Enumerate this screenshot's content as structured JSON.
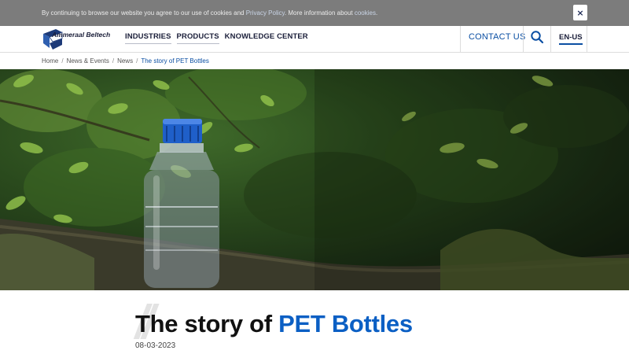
{
  "cookie_bar": {
    "text_before": "By continuing to browse our website you agree to our use of cookies and ",
    "privacy_link": "Privacy Policy",
    "text_middle": ". More information about ",
    "cookies_link": "cookies",
    "text_after": ".",
    "close_label": "×"
  },
  "header": {
    "logo_text": "Ammeraal Beltech",
    "nav": [
      "INDUSTRIES",
      "PRODUCTS",
      "KNOWLEDGE CENTER"
    ],
    "contact_label": "CONTACT US",
    "search_icon": "search-icon",
    "language": "EN-US"
  },
  "breadcrumb": [
    "Home",
    "News & Events",
    "News",
    "The story of PET Bottles"
  ],
  "article": {
    "title_plain": "The story of ",
    "title_accent": "PET Bottles",
    "date": "08-03-2023"
  },
  "colors": {
    "brand_blue": "#0b4fa3",
    "title_accent": "#0b5fc4",
    "cookie_bg": "#7c7c7c"
  }
}
